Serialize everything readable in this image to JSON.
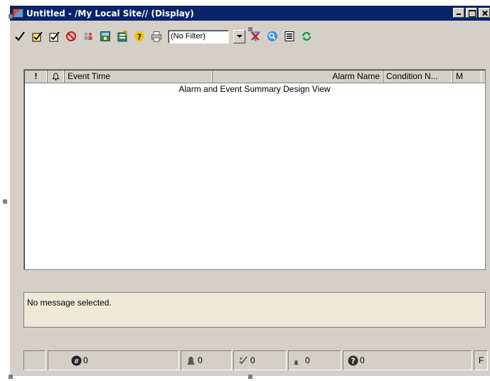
{
  "window": {
    "title": "Untitled - /My Local Site// (Display)",
    "controls": [
      "minimize",
      "maximize",
      "close"
    ]
  },
  "toolbar": {
    "buttons": [
      {
        "icon": "checkmark-icon",
        "tooltip": ""
      },
      {
        "icon": "acknowledge-page-icon"
      },
      {
        "icon": "acknowledge-all-icon"
      },
      {
        "icon": "no-entry-icon"
      },
      {
        "icon": "users-icon"
      },
      {
        "icon": "alarm-display-icon"
      },
      {
        "icon": "properties-icon"
      },
      {
        "icon": "help-icon"
      },
      {
        "icon": "printer-icon"
      }
    ],
    "filter": {
      "value": "(No Filter)"
    },
    "buttons_right": [
      {
        "icon": "clear-filter-icon"
      },
      {
        "icon": "find-icon"
      },
      {
        "icon": "list-icon"
      },
      {
        "icon": "refresh-icon"
      }
    ]
  },
  "grid": {
    "columns": [
      "!",
      "",
      "Event Time",
      "Alarm Name",
      "Condition N...",
      "M"
    ],
    "placeholder": "Alarm and Event Summary Design View"
  },
  "message": {
    "text": "No message selected."
  },
  "statusbar": {
    "panels": [
      {
        "icon": "",
        "value": ""
      },
      {
        "icon": "count-icon",
        "value": "0"
      },
      {
        "icon": "bell-icon",
        "value": "0"
      },
      {
        "icon": "acknowledged-icon",
        "value": "0"
      },
      {
        "icon": "small-bell-icon",
        "value": "0"
      },
      {
        "icon": "question-icon",
        "value": "0"
      },
      {
        "icon": "",
        "value": "F"
      }
    ]
  },
  "colors": {
    "titlebar": "#0a246a",
    "face": "#d4d0c8",
    "message_bg": "#ece9d8"
  }
}
